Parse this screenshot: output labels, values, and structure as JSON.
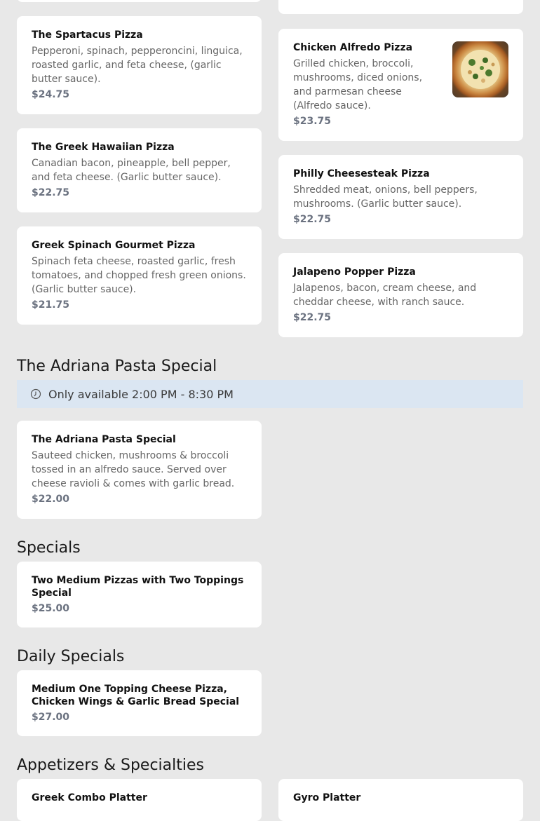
{
  "pizzas": {
    "spartacus": {
      "name": "The Spartacus Pizza",
      "desc": "Pepperoni, spinach, pepperoncini, linguica, roasted garlic, and feta cheese, (garlic butter sauce).",
      "price": "$24.75"
    },
    "greek_hawaiian": {
      "name": "The Greek Hawaiian Pizza",
      "desc": "Canadian bacon, pineapple, bell pepper, and feta cheese. (Garlic butter sauce).",
      "price": "$22.75"
    },
    "greek_spinach": {
      "name": "Greek Spinach Gourmet Pizza",
      "desc": "Spinach feta cheese, roasted garlic, fresh tomatoes, and chopped fresh green onions. (Garlic butter sauce).",
      "price": "$21.75"
    },
    "chicken_alfredo": {
      "name": "Chicken Alfredo Pizza",
      "desc": "Grilled chicken, broccoli, mushrooms, diced onions, and parmesan cheese (Alfredo sauce).",
      "price": "$23.75",
      "image_icon": "pizza-photo"
    },
    "philly": {
      "name": "Philly Cheesesteak Pizza",
      "desc": "Shredded meat, onions, bell peppers, mushrooms. (Garlic butter sauce).",
      "price": "$22.75"
    },
    "jalapeno": {
      "name": "Jalapeno Popper Pizza",
      "desc": "Jalapenos, bacon, cream cheese, and cheddar cheese, with ranch sauce.",
      "price": "$22.75"
    }
  },
  "pasta_section": {
    "title": "The Adriana Pasta Special",
    "notice": "Only available 2:00 PM - 8:30 PM",
    "notice_icon": "clock-icon",
    "notice_bg": "#dbe6f2",
    "item": {
      "name": "The Adriana Pasta Special",
      "desc": "Sauteed chicken, mushrooms & broccoli tossed in an alfredo sauce. Served over cheese ravioli & comes with garlic bread.",
      "price": "$22.00"
    }
  },
  "specials_section": {
    "title": "Specials",
    "item": {
      "name": "Two Medium Pizzas with Two Toppings Special",
      "price": "$25.00"
    }
  },
  "daily_section": {
    "title": "Daily Specials",
    "item": {
      "name": "Medium One Topping Cheese Pizza, Chicken Wings & Garlic Bread Special",
      "price": "$27.00"
    }
  },
  "appetizers_section": {
    "title": "Appetizers & Specialties",
    "items": [
      {
        "name": "Greek Combo Platter"
      },
      {
        "name": "Gyro Platter"
      }
    ]
  },
  "colors": {
    "background": "#e8e8e8",
    "card": "#ffffff",
    "price": "#6b7280",
    "description": "#666666"
  }
}
